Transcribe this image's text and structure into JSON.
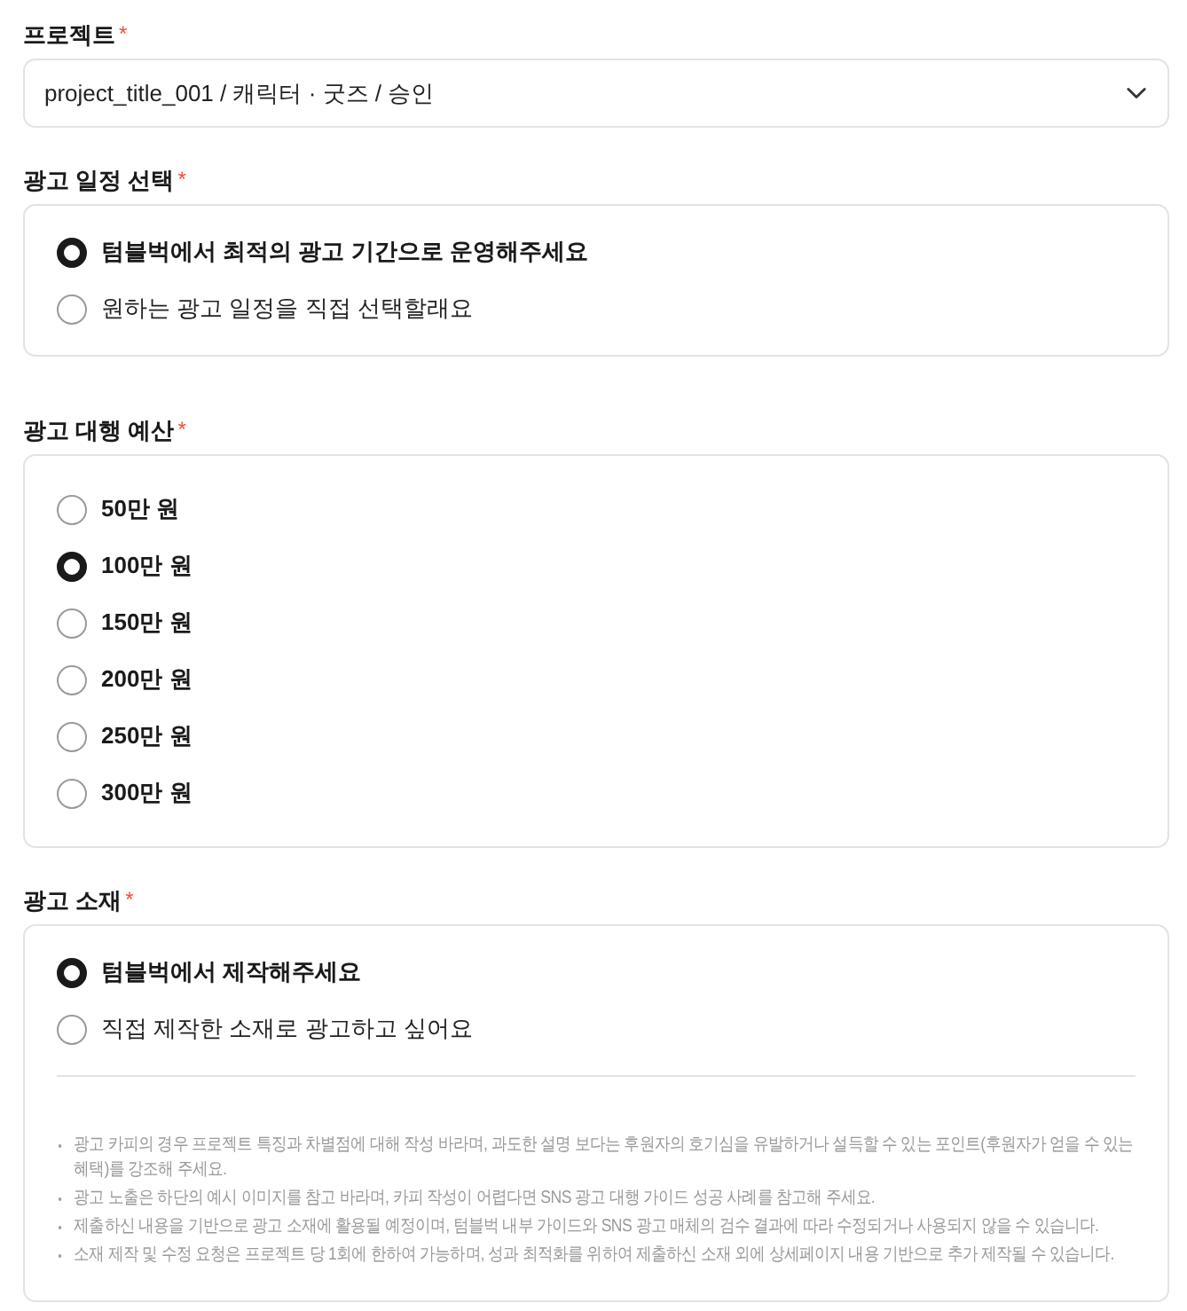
{
  "project": {
    "label": "프로젝트",
    "required_mark": "*",
    "value": "project_title_001 / 캐릭터 · 굿즈 / 승인"
  },
  "sections": [
    {
      "kind": "choice",
      "label": "광고 일정 선택",
      "required_mark": "*",
      "options": [
        {
          "label": "텀블벅에서 최적의 광고 기간으로 운영해주세요",
          "selected": true
        },
        {
          "label": "원하는 광고 일정을 직접 선택할래요",
          "selected": false
        }
      ]
    },
    {
      "kind": "amount",
      "label": "광고 대행 예산",
      "required_mark": "*",
      "options": [
        {
          "label": "50만 원",
          "selected": false
        },
        {
          "label": "100만 원",
          "selected": true
        },
        {
          "label": "150만 원",
          "selected": false
        },
        {
          "label": "200만 원",
          "selected": false
        },
        {
          "label": "250만 원",
          "selected": false
        },
        {
          "label": "300만 원",
          "selected": false
        }
      ]
    },
    {
      "kind": "choice",
      "label": "광고 소재",
      "required_mark": "*",
      "options": [
        {
          "label": "텀블벅에서 제작해주세요",
          "selected": true
        },
        {
          "label": "직접 제작한 소재로 광고하고 싶어요",
          "selected": false
        }
      ],
      "notes": [
        "광고 카피의 경우 프로젝트 특징과 차별점에 대해 작성 바라며, 과도한 설명 보다는 후원자의 호기심을 유발하거나 설득할 수 있는 포인트(후원자가 얻을 수 있는 혜택)를 강조해 주세요.",
        "광고 노출은 하단의 예시 이미지를 참고 바라며, 카피 작성이 어렵다면 SNS 광고 대행 가이드 성공 사례를 참고해 주세요.",
        "제출하신 내용을 기반으로 광고 소재에 활용될 예정이며, 텀블벅 내부 가이드와 SNS 광고 매체의 검수 결과에 따라 수정되거나 사용되지 않을 수 있습니다.",
        "소재 제작 및 수정 요청은 프로젝트 당 1회에 한하여 가능하며, 성과 최적화를 위하여 제출하신 소재 외에 상세페이지 내용 기반으로 추가 제작될 수 있습니다."
      ]
    }
  ]
}
